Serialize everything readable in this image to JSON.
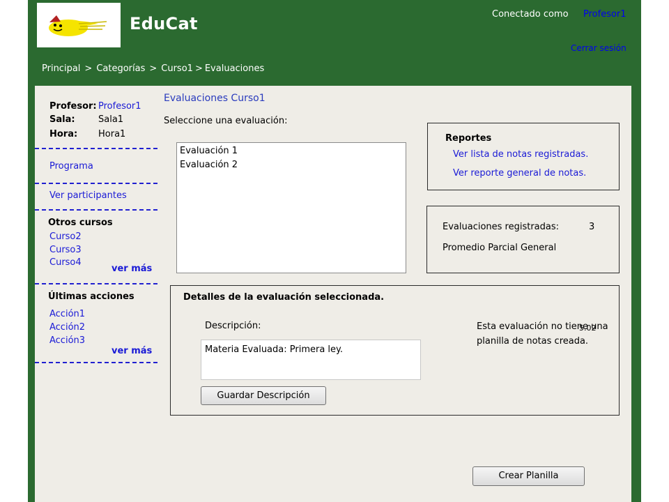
{
  "app": {
    "title": "EduCat",
    "logo_icon": "cat-logo-icon",
    "colors": {
      "frame": "#2b6a30",
      "content_bg": "#efede7",
      "link": "#1a1ad6",
      "logo_yellow": "#f5e400"
    }
  },
  "session": {
    "connected_label": "Conectado como",
    "user": "Profesor1",
    "logout": "Cerrar sesión"
  },
  "breadcrumb": {
    "items": [
      "Principal",
      "Categorías",
      "Curso1",
      "Evaluaciones"
    ],
    "separator": ">"
  },
  "sidebar": {
    "profesor_label": "Profesor:",
    "profesor_value": "Profesor1",
    "sala_label": "Sala:",
    "sala_value": "Sala1",
    "hora_label": "Hora:",
    "hora_value": "Hora1",
    "programa": "Programa",
    "participantes": "Ver participantes",
    "otros_cursos_title": "Otros cursos",
    "otros_cursos": [
      "Curso2",
      "Curso3",
      "Curso4"
    ],
    "ver_mas": "ver más",
    "ultimas_title": "Últimas acciones",
    "acciones": [
      "Acción1",
      "Acción2",
      "Acción3"
    ]
  },
  "main": {
    "title": "Evaluaciones Curso1",
    "select_label": "Seleccione una evaluación:",
    "evaluations": [
      "Evaluación 1",
      "Evaluación 2"
    ]
  },
  "reports": {
    "title": "Reportes",
    "link1": "Ver lista de notas registradas.",
    "link2": "Ver reporte general de notas."
  },
  "stats": {
    "registered_label": "Evaluaciones registradas:",
    "registered_value": "3",
    "average_label": "Promedio Parcial General",
    "average_value": "5.02"
  },
  "details": {
    "title": "Detalles de la evaluación seleccionada.",
    "description_label": "Descripción:",
    "description_value": "Materia Evaluada: Primera ley.",
    "note": "Esta evaluación no tiene una planilla de notas creada.",
    "save_button": "Guardar Descripción"
  },
  "actions": {
    "create_button": "Crear Planilla"
  }
}
